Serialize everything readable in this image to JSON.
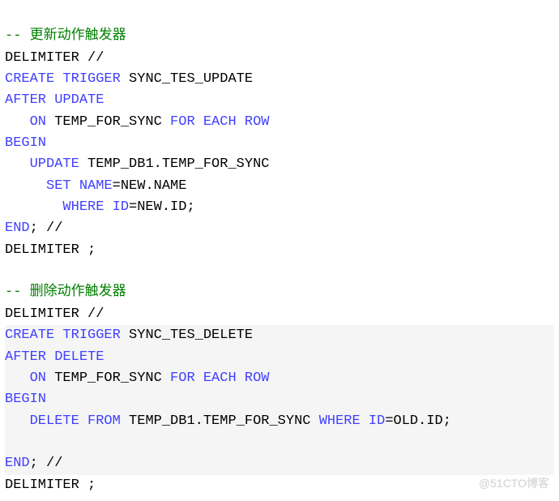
{
  "block1": {
    "line1": "-- 更新动作触发器",
    "line2": "DELIMITER //",
    "line3_a": "CREATE",
    "line3_b": " TRIGGER",
    "line3_c": " SYNC_TES_UPDATE",
    "line4_a": "AFTER",
    "line4_b": " UPDATE",
    "line5_a": "   ON",
    "line5_b": " TEMP_FOR_SYNC ",
    "line5_c": "FOR",
    "line5_d": " EACH",
    "line5_e": " ROW",
    "line6": "BEGIN",
    "line7_a": "   UPDATE",
    "line7_b": " TEMP_DB1.TEMP_FOR_SYNC",
    "line8_a": "     SET",
    "line8_b": " NAME",
    "line8_c": "=NEW.NAME",
    "line9_a": "       WHERE",
    "line9_b": " ID",
    "line9_c": "=NEW.ID;",
    "line10_a": "END",
    "line10_b": "; //",
    "line11": "DELIMITER ;"
  },
  "block2": {
    "line1": "-- 删除动作触发器",
    "line2": "DELIMITER //",
    "line3_a": "CREATE",
    "line3_b": " TRIGGER",
    "line3_c": " SYNC_TES_DELETE",
    "line4_a": "AFTER",
    "line4_b": " DELETE",
    "line5_a": "   ON",
    "line5_b": " TEMP_FOR_SYNC ",
    "line5_c": "FOR",
    "line5_d": " EACH",
    "line5_e": " ROW",
    "line6": "BEGIN",
    "line7_a": "   DELETE",
    "line7_b": " FROM",
    "line7_c": " TEMP_DB1.TEMP_FOR_SYNC ",
    "line7_d": "WHERE",
    "line7_e": " ID",
    "line7_f": "=OLD.ID;",
    "line8": "",
    "line9_a": "END",
    "line9_b": "; //",
    "line10": "DELIMITER ;"
  },
  "watermark": "@51CTO博客"
}
